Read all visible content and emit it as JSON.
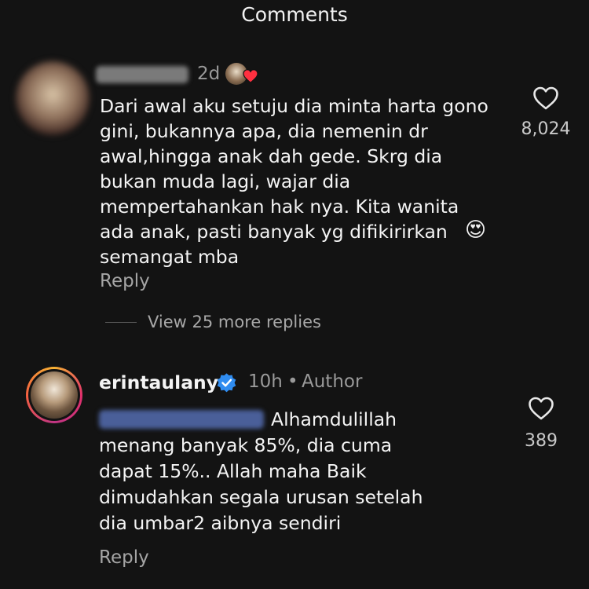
{
  "header": {
    "title": "Comments"
  },
  "comments": [
    {
      "time": "2d",
      "lines": [
        "Dari awal aku setuju dia minta harta gono",
        "gini, bukannya apa, dia nemenin dr",
        "awal,hingga anak dah gede. Skrg dia",
        "bukan muda lagi, wajar dia",
        "mempertahankan hak nya. Kita wanita",
        "ada anak, pasti banyak yg difikirirkan",
        "semangat mba"
      ],
      "emoji": "😍",
      "like_count": "8,024",
      "reply_label": "Reply",
      "view_more": "View 25 more replies",
      "liked_by_author_icon": "heart-badge-icon"
    },
    {
      "username": "erintaulany",
      "verified_icon": "verified-badge-icon",
      "time": "10h",
      "separator": "•",
      "author_label": "Author",
      "lines": [
        "Alhamdulillah",
        "menang banyak 85%, dia cuma",
        "dapat 15%.. Allah maha Baik",
        "dimudahkan segala urusan setelah",
        "dia umbar2 aibnya sendiri"
      ],
      "like_count": "389",
      "reply_label": "Reply"
    }
  ],
  "colors": {
    "background": "#131313",
    "verified": "#2f8cf0",
    "heart_red": "#ff3040"
  }
}
